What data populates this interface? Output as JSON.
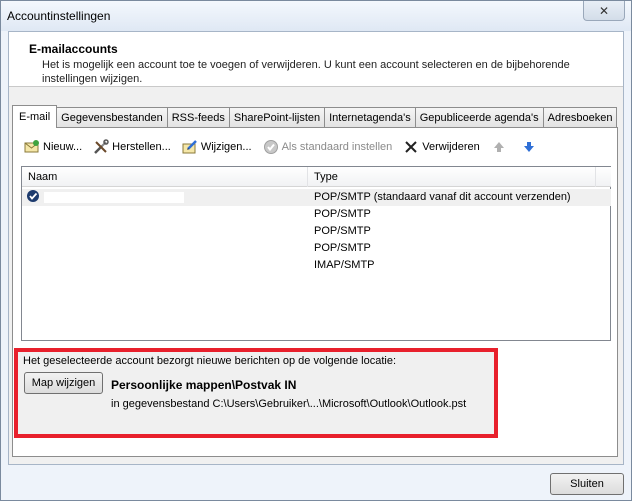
{
  "window": {
    "title": "Accountinstellingen",
    "close_glyph": "✕"
  },
  "header": {
    "title": "E-mailaccounts",
    "description": "Het is mogelijk een account toe te voegen of verwijderen. U kunt een account selecteren en de bijbehorende instellingen wijzigen."
  },
  "tabs": [
    {
      "label": "E-mail",
      "active": true
    },
    {
      "label": "Gegevensbestanden"
    },
    {
      "label": "RSS-feeds"
    },
    {
      "label": "SharePoint-lijsten"
    },
    {
      "label": "Internetagenda's"
    },
    {
      "label": "Gepubliceerde agenda's"
    },
    {
      "label": "Adresboeken"
    }
  ],
  "toolbar": {
    "new": "Nieuw...",
    "repair": "Herstellen...",
    "change": "Wijzigen...",
    "set_default": "Als standaard instellen",
    "remove": "Verwijderen"
  },
  "list": {
    "columns": {
      "name": "Naam",
      "type": "Type"
    },
    "rows": [
      {
        "name": "",
        "type": "POP/SMTP (standaard vanaf dit account verzenden)",
        "default": true
      },
      {
        "name": "",
        "type": "POP/SMTP"
      },
      {
        "name": "",
        "type": "POP/SMTP"
      },
      {
        "name": "",
        "type": "POP/SMTP"
      },
      {
        "name": "",
        "type": "IMAP/SMTP"
      }
    ]
  },
  "location": {
    "label": "Het geselecteerde account bezorgt nieuwe berichten op de volgende locatie:",
    "button": "Map wijzigen",
    "folder": "Persoonlijke mappen\\Postvak IN",
    "file": "in gegevensbestand C:\\Users\\Gebruiker\\...\\Microsoft\\Outlook\\Outlook.pst"
  },
  "footer": {
    "close_button": "Sluiten"
  },
  "colors": {
    "highlight_border": "#e8202c",
    "accent_blue": "#2f6fd6"
  }
}
